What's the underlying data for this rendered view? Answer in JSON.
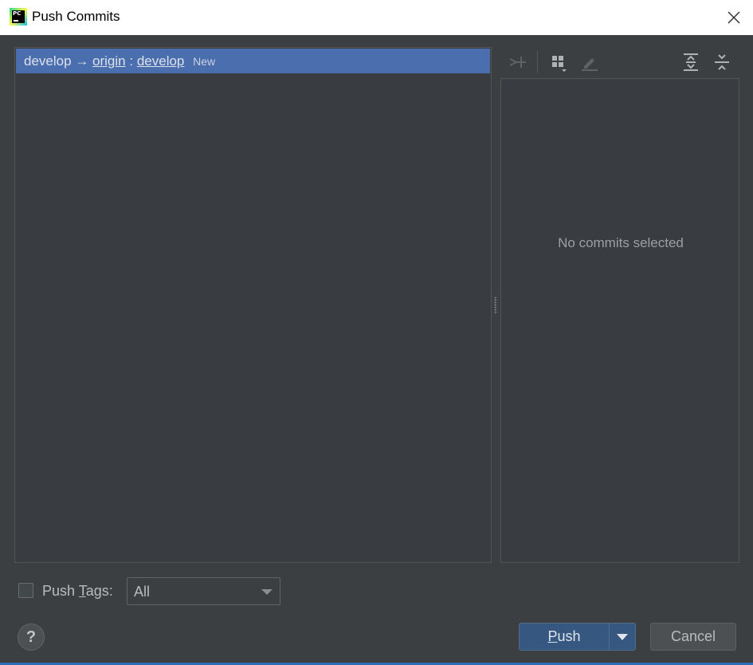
{
  "window": {
    "title": "Push Commits",
    "app_icon": "pycharm-icon",
    "app_icon_text": "PC"
  },
  "left": {
    "branch": {
      "local": "develop",
      "arrow": "→",
      "remote": "origin",
      "separator": ":",
      "remote_branch": "develop",
      "badge": "New"
    }
  },
  "right": {
    "toolbar_icons": [
      "merge-icon",
      "group-icon",
      "edit-icon",
      "expand-all-icon",
      "collapse-all-icon"
    ],
    "empty_text": "No commits selected"
  },
  "bottom": {
    "push_tags_label_pre": "Push ",
    "push_tags_mnemonic": "T",
    "push_tags_label_post": "ags:",
    "tags_selected": "All",
    "help": "?",
    "push_mnemonic": "P",
    "push_label_rest": "ush",
    "cancel_label": "Cancel"
  },
  "colors": {
    "background": "#3c3f41",
    "selection": "#4b6eaf",
    "primary_button": "#365880"
  }
}
